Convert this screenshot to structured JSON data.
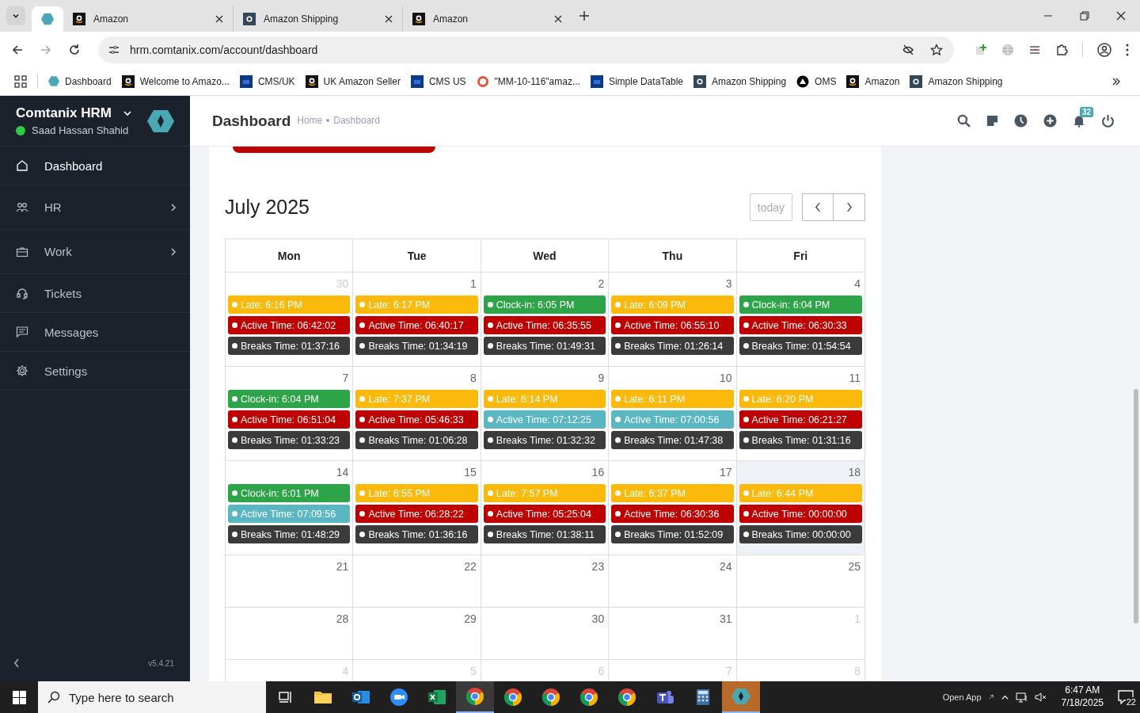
{
  "browser": {
    "tabs": [
      {
        "kind": "hex",
        "selected": true
      },
      {
        "title": "Amazon",
        "kind": "a-black",
        "selected": false
      },
      {
        "title": "Amazon Shipping",
        "kind": "a-slate",
        "selected": false
      },
      {
        "title": "Amazon",
        "kind": "a-black",
        "selected": false
      }
    ],
    "url": "hrm.comtanix.com/account/dashboard",
    "bookmarks": [
      {
        "label": "Dashboard",
        "kind": "hex"
      },
      {
        "label": "Welcome to Amazo...",
        "kind": "a-black"
      },
      {
        "label": "CMS/UK",
        "kind": "df"
      },
      {
        "label": "UK Amazon Seller",
        "kind": "a-black"
      },
      {
        "label": "CMS US",
        "kind": "df"
      },
      {
        "label": "\"MM-10-116\"amaz...",
        "kind": "duck"
      },
      {
        "label": "Simple DataTable",
        "kind": "df"
      },
      {
        "label": "Amazon Shipping",
        "kind": "a-slate"
      },
      {
        "label": "OMS",
        "kind": "triangle"
      },
      {
        "label": "Amazon",
        "kind": "a-black"
      },
      {
        "label": "Amazon Shipping",
        "kind": "a-slate"
      }
    ]
  },
  "sidebar": {
    "brand": "Comtanix HRM",
    "user": "Saad Hassan Shahid",
    "online": true,
    "items": [
      {
        "label": "Dashboard",
        "kind": "home",
        "selected": true,
        "submenu": false
      },
      {
        "label": "HR",
        "kind": "people",
        "selected": false,
        "submenu": true
      },
      {
        "label": "Work",
        "kind": "briefcase",
        "selected": false,
        "submenu": true
      },
      {
        "label": "Tickets",
        "kind": "headset",
        "selected": false,
        "submenu": false
      },
      {
        "label": "Messages",
        "kind": "message",
        "selected": false,
        "submenu": false
      },
      {
        "label": "Settings",
        "kind": "gear",
        "selected": false,
        "submenu": false
      }
    ],
    "version": "v5.4.21"
  },
  "header": {
    "title": "Dashboard",
    "breadcrumb": [
      "Home",
      "Dashboard"
    ],
    "notification_count": "32"
  },
  "calendar": {
    "title": "July 2025",
    "today_button": {
      "label": "today",
      "disabled": true
    },
    "weekdays": [
      "Mon",
      "Tue",
      "Wed",
      "Thu",
      "Fri"
    ],
    "weeks": [
      {
        "days": [
          {
            "date": "30",
            "other_month": true,
            "today": false,
            "events": [
              {
                "label": "Late: 6:16 PM",
                "color": "#fbb90b"
              },
              {
                "label": "Active Time: 06:42:02",
                "color": "#bf0000"
              },
              {
                "label": "Breaks Time: 01:37:16",
                "color": "#3b3b3b"
              }
            ]
          },
          {
            "date": "1",
            "other_month": false,
            "today": false,
            "events": [
              {
                "label": "Late: 6:17 PM",
                "color": "#fbb90b"
              },
              {
                "label": "Active Time: 06:40:17",
                "color": "#bf0000"
              },
              {
                "label": "Breaks Time: 01:34:19",
                "color": "#3b3b3b"
              }
            ]
          },
          {
            "date": "2",
            "other_month": false,
            "today": false,
            "events": [
              {
                "label": "Clock-in: 6:05 PM",
                "color": "#2ca447"
              },
              {
                "label": "Active Time: 06:35:55",
                "color": "#bf0000"
              },
              {
                "label": "Breaks Time: 01:49:31",
                "color": "#3b3b3b"
              }
            ]
          },
          {
            "date": "3",
            "other_month": false,
            "today": false,
            "events": [
              {
                "label": "Late: 6:09 PM",
                "color": "#fbb90b"
              },
              {
                "label": "Active Time: 06:55:10",
                "color": "#bf0000"
              },
              {
                "label": "Breaks Time: 01:26:14",
                "color": "#3b3b3b"
              }
            ]
          },
          {
            "date": "4",
            "other_month": false,
            "today": false,
            "events": [
              {
                "label": "Clock-in: 6:04 PM",
                "color": "#2ca447"
              },
              {
                "label": "Active Time: 06:30:33",
                "color": "#bf0000"
              },
              {
                "label": "Breaks Time: 01:54:54",
                "color": "#3b3b3b"
              }
            ]
          }
        ]
      },
      {
        "days": [
          {
            "date": "7",
            "other_month": false,
            "today": false,
            "events": [
              {
                "label": "Clock-in: 6:04 PM",
                "color": "#2ca447"
              },
              {
                "label": "Active Time: 06:51:04",
                "color": "#bf0000"
              },
              {
                "label": "Breaks Time: 01:33:23",
                "color": "#3b3b3b"
              }
            ]
          },
          {
            "date": "8",
            "other_month": false,
            "today": false,
            "events": [
              {
                "label": "Late: 7:37 PM",
                "color": "#fbb90b"
              },
              {
                "label": "Active Time: 05:46:33",
                "color": "#bf0000"
              },
              {
                "label": "Breaks Time: 01:06:28",
                "color": "#3b3b3b"
              }
            ]
          },
          {
            "date": "9",
            "other_month": false,
            "today": false,
            "events": [
              {
                "label": "Late: 6:14 PM",
                "color": "#fbb90b"
              },
              {
                "label": "Active Time: 07:12:25",
                "color": "#5ab7c2"
              },
              {
                "label": "Breaks Time: 01:32:32",
                "color": "#3b3b3b"
              }
            ]
          },
          {
            "date": "10",
            "other_month": false,
            "today": false,
            "events": [
              {
                "label": "Late: 6:11 PM",
                "color": "#fbb90b"
              },
              {
                "label": "Active Time: 07:00:56",
                "color": "#5ab7c2"
              },
              {
                "label": "Breaks Time: 01:47:38",
                "color": "#3b3b3b"
              }
            ]
          },
          {
            "date": "11",
            "other_month": false,
            "today": false,
            "events": [
              {
                "label": "Late: 6:20 PM",
                "color": "#fbb90b"
              },
              {
                "label": "Active Time: 06:21:27",
                "color": "#bf0000"
              },
              {
                "label": "Breaks Time: 01:31:16",
                "color": "#3b3b3b"
              }
            ]
          }
        ]
      },
      {
        "days": [
          {
            "date": "14",
            "other_month": false,
            "today": false,
            "events": [
              {
                "label": "Clock-in: 6:01 PM",
                "color": "#2ca447"
              },
              {
                "label": "Active Time: 07:09:56",
                "color": "#5ab7c2"
              },
              {
                "label": "Breaks Time: 01:48:29",
                "color": "#3b3b3b"
              }
            ]
          },
          {
            "date": "15",
            "other_month": false,
            "today": false,
            "events": [
              {
                "label": "Late: 6:55 PM",
                "color": "#fbb90b"
              },
              {
                "label": "Active Time: 06:28:22",
                "color": "#bf0000"
              },
              {
                "label": "Breaks Time: 01:36:16",
                "color": "#3b3b3b"
              }
            ]
          },
          {
            "date": "16",
            "other_month": false,
            "today": false,
            "events": [
              {
                "label": "Late: 7:57 PM",
                "color": "#fbb90b"
              },
              {
                "label": "Active Time: 05:25:04",
                "color": "#bf0000"
              },
              {
                "label": "Breaks Time: 01:38:11",
                "color": "#3b3b3b"
              }
            ]
          },
          {
            "date": "17",
            "other_month": false,
            "today": false,
            "events": [
              {
                "label": "Late: 6:37 PM",
                "color": "#fbb90b"
              },
              {
                "label": "Active Time: 06:30:36",
                "color": "#bf0000"
              },
              {
                "label": "Breaks Time: 01:52:09",
                "color": "#3b3b3b"
              }
            ]
          },
          {
            "date": "18",
            "other_month": false,
            "today": true,
            "events": [
              {
                "label": "Late: 6:44 PM",
                "color": "#fbb90b"
              },
              {
                "label": "Active Time: 00:00:00",
                "color": "#bf0000"
              },
              {
                "label": "Breaks Time: 00:00:00",
                "color": "#3b3b3b"
              }
            ]
          }
        ]
      },
      {
        "days": [
          {
            "date": "21",
            "other_month": false,
            "today": false
          },
          {
            "date": "22",
            "other_month": false,
            "today": false
          },
          {
            "date": "23",
            "other_month": false,
            "today": false
          },
          {
            "date": "24",
            "other_month": false,
            "today": false
          },
          {
            "date": "25",
            "other_month": false,
            "today": false
          }
        ]
      },
      {
        "days": [
          {
            "date": "28",
            "other_month": false,
            "today": false
          },
          {
            "date": "29",
            "other_month": false,
            "today": false
          },
          {
            "date": "30",
            "other_month": false,
            "today": false
          },
          {
            "date": "31",
            "other_month": false,
            "today": false
          },
          {
            "date": "1",
            "other_month": true,
            "today": false
          }
        ]
      },
      {
        "days": [
          {
            "date": "4",
            "other_month": true,
            "today": false
          },
          {
            "date": "5",
            "other_month": true,
            "today": false
          },
          {
            "date": "6",
            "other_month": true,
            "today": false
          },
          {
            "date": "7",
            "other_month": true,
            "today": false
          },
          {
            "date": "8",
            "other_month": true,
            "today": false
          }
        ]
      }
    ]
  },
  "taskbar": {
    "search_placeholder": "Type here to search",
    "apps": [
      {
        "kind": "taskview",
        "selected": false
      },
      {
        "kind": "folder",
        "selected": false
      },
      {
        "kind": "mail",
        "selected": false
      },
      {
        "kind": "video",
        "selected": false
      },
      {
        "kind": "sheet",
        "selected": false
      },
      {
        "kind": "browser",
        "selected": true
      },
      {
        "kind": "browser",
        "selected": false
      },
      {
        "kind": "browser",
        "selected": false
      },
      {
        "kind": "browser",
        "selected": false
      },
      {
        "kind": "browser",
        "selected": false
      },
      {
        "kind": "chat",
        "selected": false
      },
      {
        "kind": "calculator",
        "selected": false
      },
      {
        "kind": "hex",
        "selected": true
      }
    ],
    "open_app": "Open App",
    "time": "6:47 AM",
    "date": "7/18/2025",
    "notifications": "22"
  }
}
